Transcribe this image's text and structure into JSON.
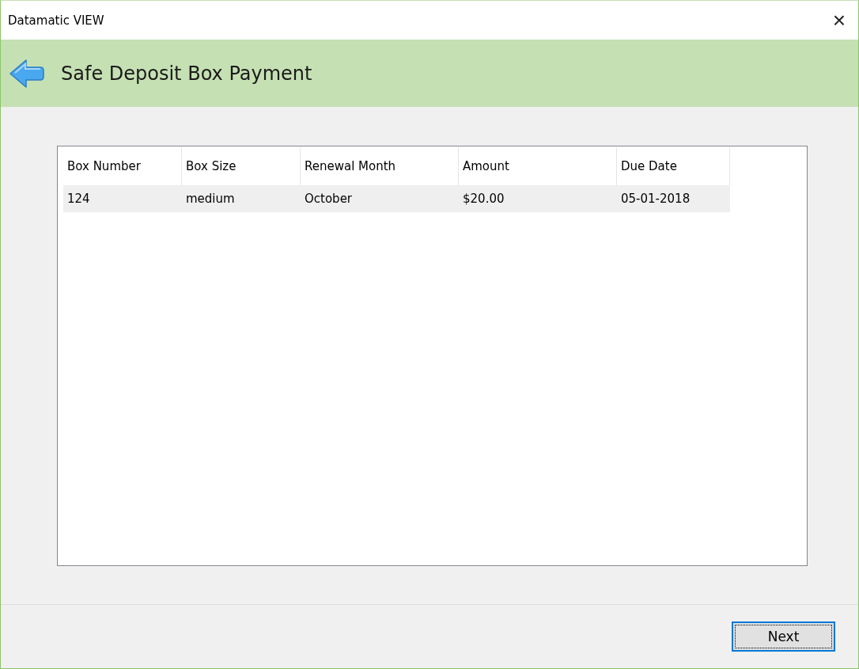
{
  "window": {
    "title": "Datamatic VIEW",
    "close": "×"
  },
  "header": {
    "title": "Safe Deposit Box Payment"
  },
  "table": {
    "columns": [
      "Box Number",
      "Box Size",
      "Renewal Month",
      "Amount",
      "Due Date"
    ],
    "rows": [
      {
        "cells": [
          "124",
          "medium",
          "October",
          "$20.00",
          "05-01-2018"
        ],
        "selected": true
      }
    ]
  },
  "buttons": [
    {
      "label": "Next",
      "focused": true
    }
  ]
}
